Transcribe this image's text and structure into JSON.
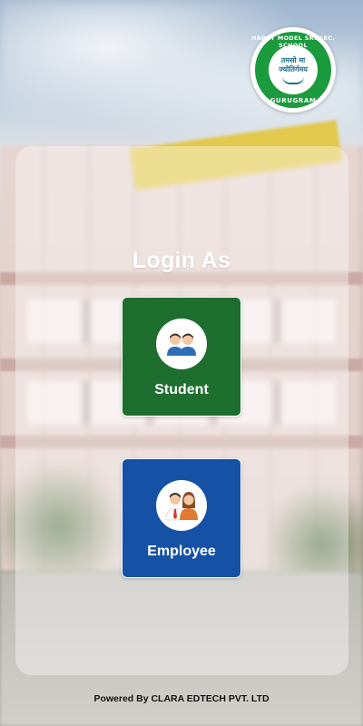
{
  "logo": {
    "arc_top": "HAPPY MODEL SR. SEC. SCHOOL",
    "arc_bottom": "GURUGRAM",
    "motto_line1": "तमसो मा",
    "motto_line2": "ज्योतिर्गमय"
  },
  "login": {
    "title": "Login As",
    "options": [
      {
        "label": "Student",
        "icon": "students-icon",
        "color": "#1e6e2f"
      },
      {
        "label": "Employee",
        "icon": "employees-icon",
        "color": "#1552a5"
      }
    ]
  },
  "footer": {
    "text": "Powered By CLARA EDTECH PVT. LTD"
  }
}
